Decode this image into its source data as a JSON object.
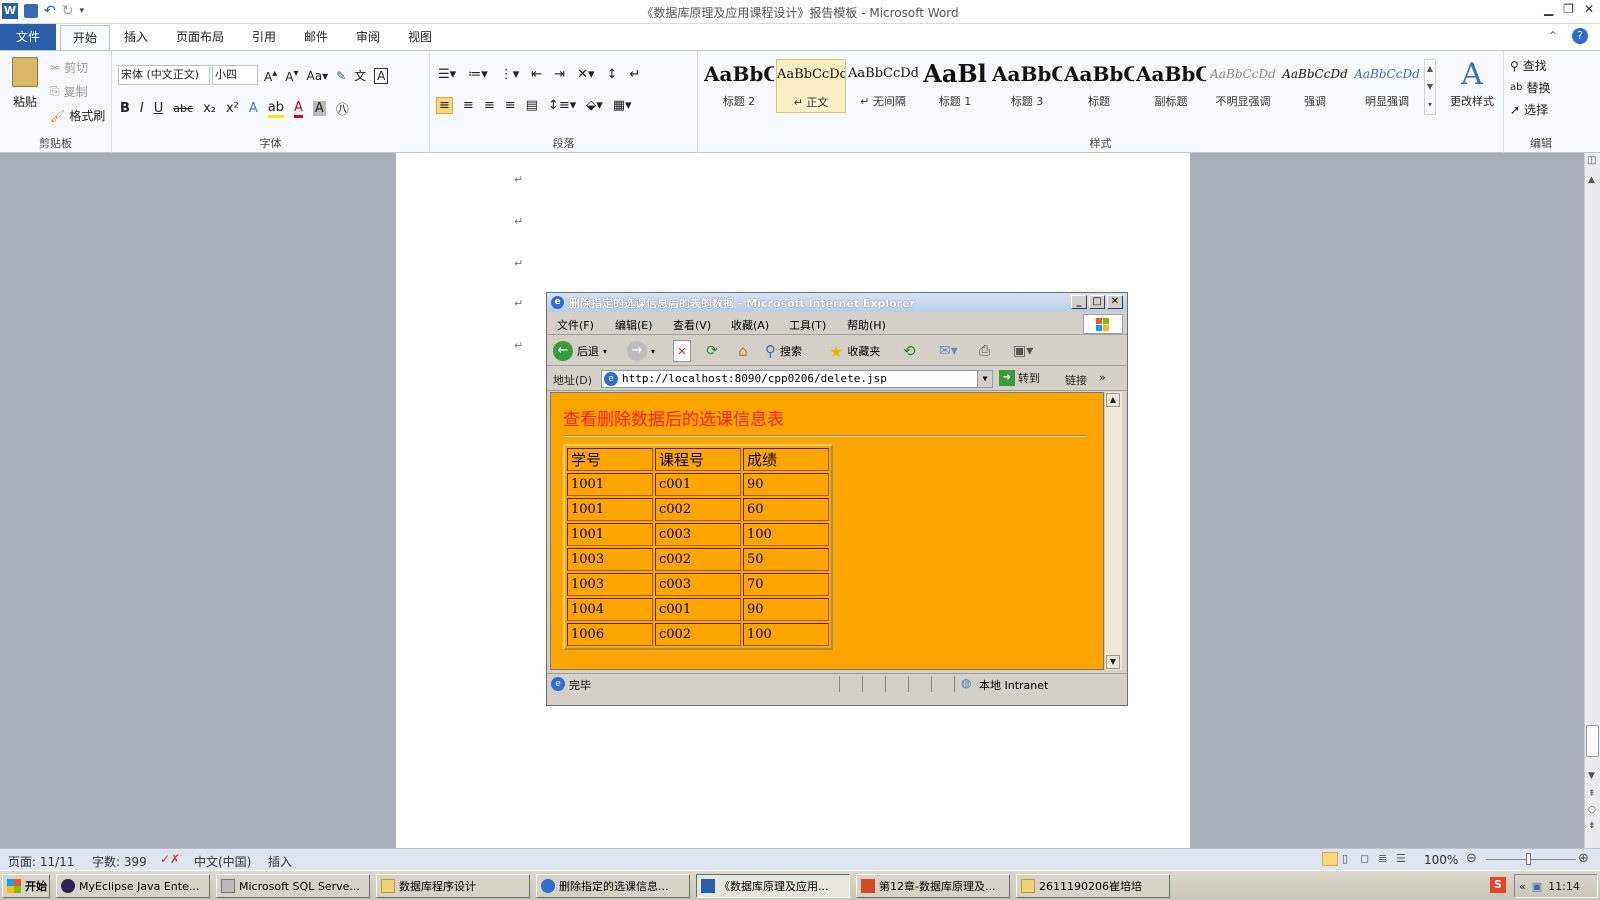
{
  "word": {
    "title": "《数据库原理及应用课程设计》报告模板 - Microsoft Word",
    "tabs": [
      "文件",
      "开始",
      "插入",
      "页面布局",
      "引用",
      "邮件",
      "审阅",
      "视图"
    ],
    "clipboard": {
      "paste": "粘贴",
      "cut": "剪切",
      "copy": "复制",
      "format_painter": "格式刷",
      "group": "剪贴板"
    },
    "font": {
      "name": "宋体 (中文正文)",
      "size": "小四",
      "group": "字体"
    },
    "paragraph": {
      "group": "段落"
    },
    "styles": {
      "group": "样式",
      "items": [
        {
          "preview": "AaBbC",
          "label": "标题 2"
        },
        {
          "preview": "AaBbCcDd",
          "label": "↵ 正文"
        },
        {
          "preview": "AaBbCcDd",
          "label": "↵ 无间隔"
        },
        {
          "preview": "AaBl",
          "label": "标题 1"
        },
        {
          "preview": "AaBbC",
          "label": "标题 3"
        },
        {
          "preview": "AaBbC",
          "label": "标题"
        },
        {
          "preview": "AaBbC",
          "label": "副标题"
        },
        {
          "preview": "AaBbCcDd",
          "label": "不明显强调"
        },
        {
          "preview": "AaBbCcDd",
          "label": "强调"
        },
        {
          "preview": "AaBbCcDd",
          "label": "明显强调"
        }
      ],
      "change": "更改样式"
    },
    "editing": {
      "find": "查找",
      "replace": "替换",
      "select": "选择",
      "group": "编辑"
    },
    "paragraph_marks": [
      "↵",
      "↵",
      "↵",
      "↵",
      "↵"
    ],
    "status": {
      "page": "页面: 11/11",
      "words": "字数: 399",
      "lang": "中文(中国)",
      "mode": "插入",
      "zoom": "100%"
    }
  },
  "ie": {
    "title": "删除指定的选课信息后的表的数据 - Microsoft Internet Explorer",
    "menu": [
      "文件(F)",
      "编辑(E)",
      "查看(V)",
      "收藏(A)",
      "工具(T)",
      "帮助(H)"
    ],
    "toolbar": {
      "back": "后退",
      "search": "搜索",
      "favorites": "收藏夹"
    },
    "address_label": "地址(D)",
    "url": "http://localhost:8090/cpp0206/delete.jsp",
    "go": "转到",
    "links": "链接",
    "page_heading": "查看删除数据后的选课信息表",
    "table": {
      "headers": [
        "学号",
        "课程号",
        "成绩"
      ],
      "rows": [
        [
          "1001",
          "c001",
          "90"
        ],
        [
          "1001",
          "c002",
          "60"
        ],
        [
          "1001",
          "c003",
          "100"
        ],
        [
          "1003",
          "c002",
          "50"
        ],
        [
          "1003",
          "c003",
          "70"
        ],
        [
          "1004",
          "c001",
          "90"
        ],
        [
          "1006",
          "c002",
          "100"
        ]
      ]
    },
    "status_done": "完毕",
    "status_zone": "本地 Intranet"
  },
  "taskbar": {
    "start": "开始",
    "items": [
      "MyEclipse Java Ente...",
      "Microsoft SQL Serve...",
      "数据库程序设计",
      "删除指定的选课信息...",
      "《数据库原理及应用...",
      "第12章-数据库原理及...",
      "2611190206崔培培"
    ],
    "clock": "11:14"
  }
}
